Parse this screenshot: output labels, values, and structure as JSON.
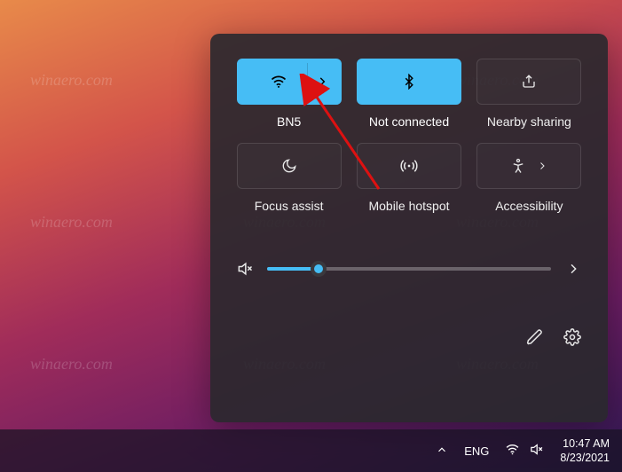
{
  "tiles": {
    "wifi": {
      "label": "BN5",
      "active": true
    },
    "bluetooth": {
      "label": "Not connected",
      "active": true
    },
    "share": {
      "label": "Nearby sharing",
      "active": false
    },
    "focus": {
      "label": "Focus assist",
      "active": false
    },
    "hotspot": {
      "label": "Mobile hotspot",
      "active": false
    },
    "accessibility": {
      "label": "Accessibility",
      "active": false
    }
  },
  "volume": {
    "percent": 18
  },
  "taskbar": {
    "lang": "ENG",
    "time": "10:47 AM",
    "date": "8/23/2021"
  },
  "watermark": "winaero.com"
}
